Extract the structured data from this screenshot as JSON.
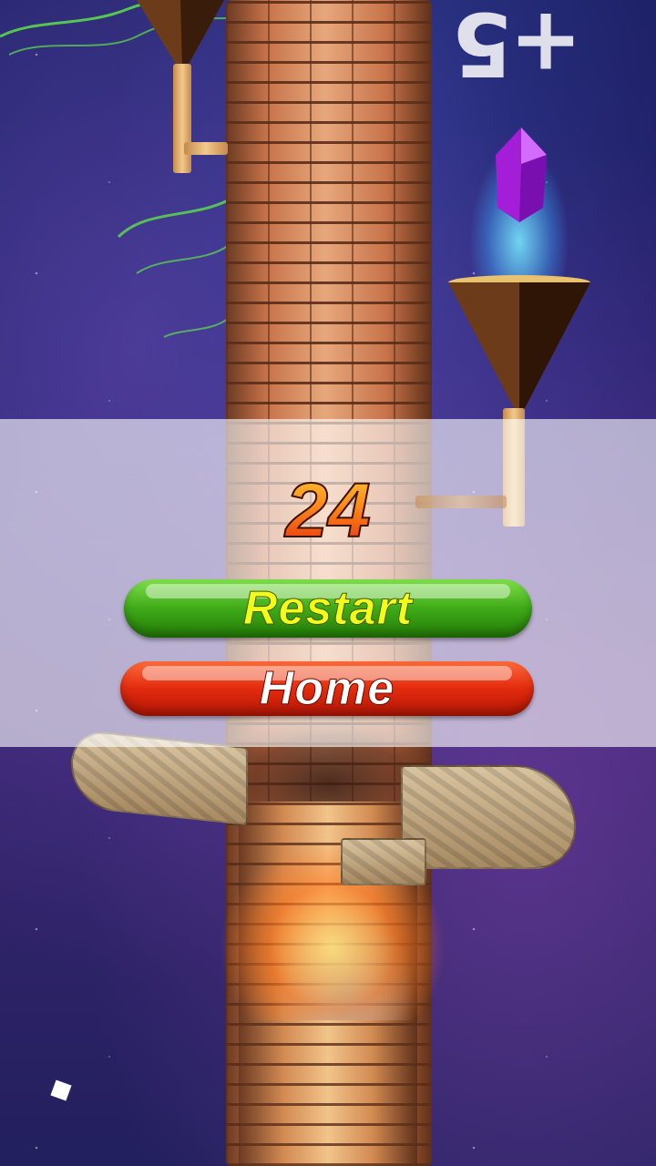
{
  "game": {
    "score": "24",
    "bonus_popup": "+5",
    "restart_label": "Restart",
    "home_label": "Home"
  },
  "colors": {
    "restart_button": "#3faa18",
    "restart_text": "#f2ff1a",
    "home_button": "#e22b0e",
    "home_text": "#ffffff",
    "score_fill": "#ff8a1a"
  },
  "icons": [
    "purple-gem-icon",
    "funnel-icon",
    "sparkle-icon"
  ]
}
